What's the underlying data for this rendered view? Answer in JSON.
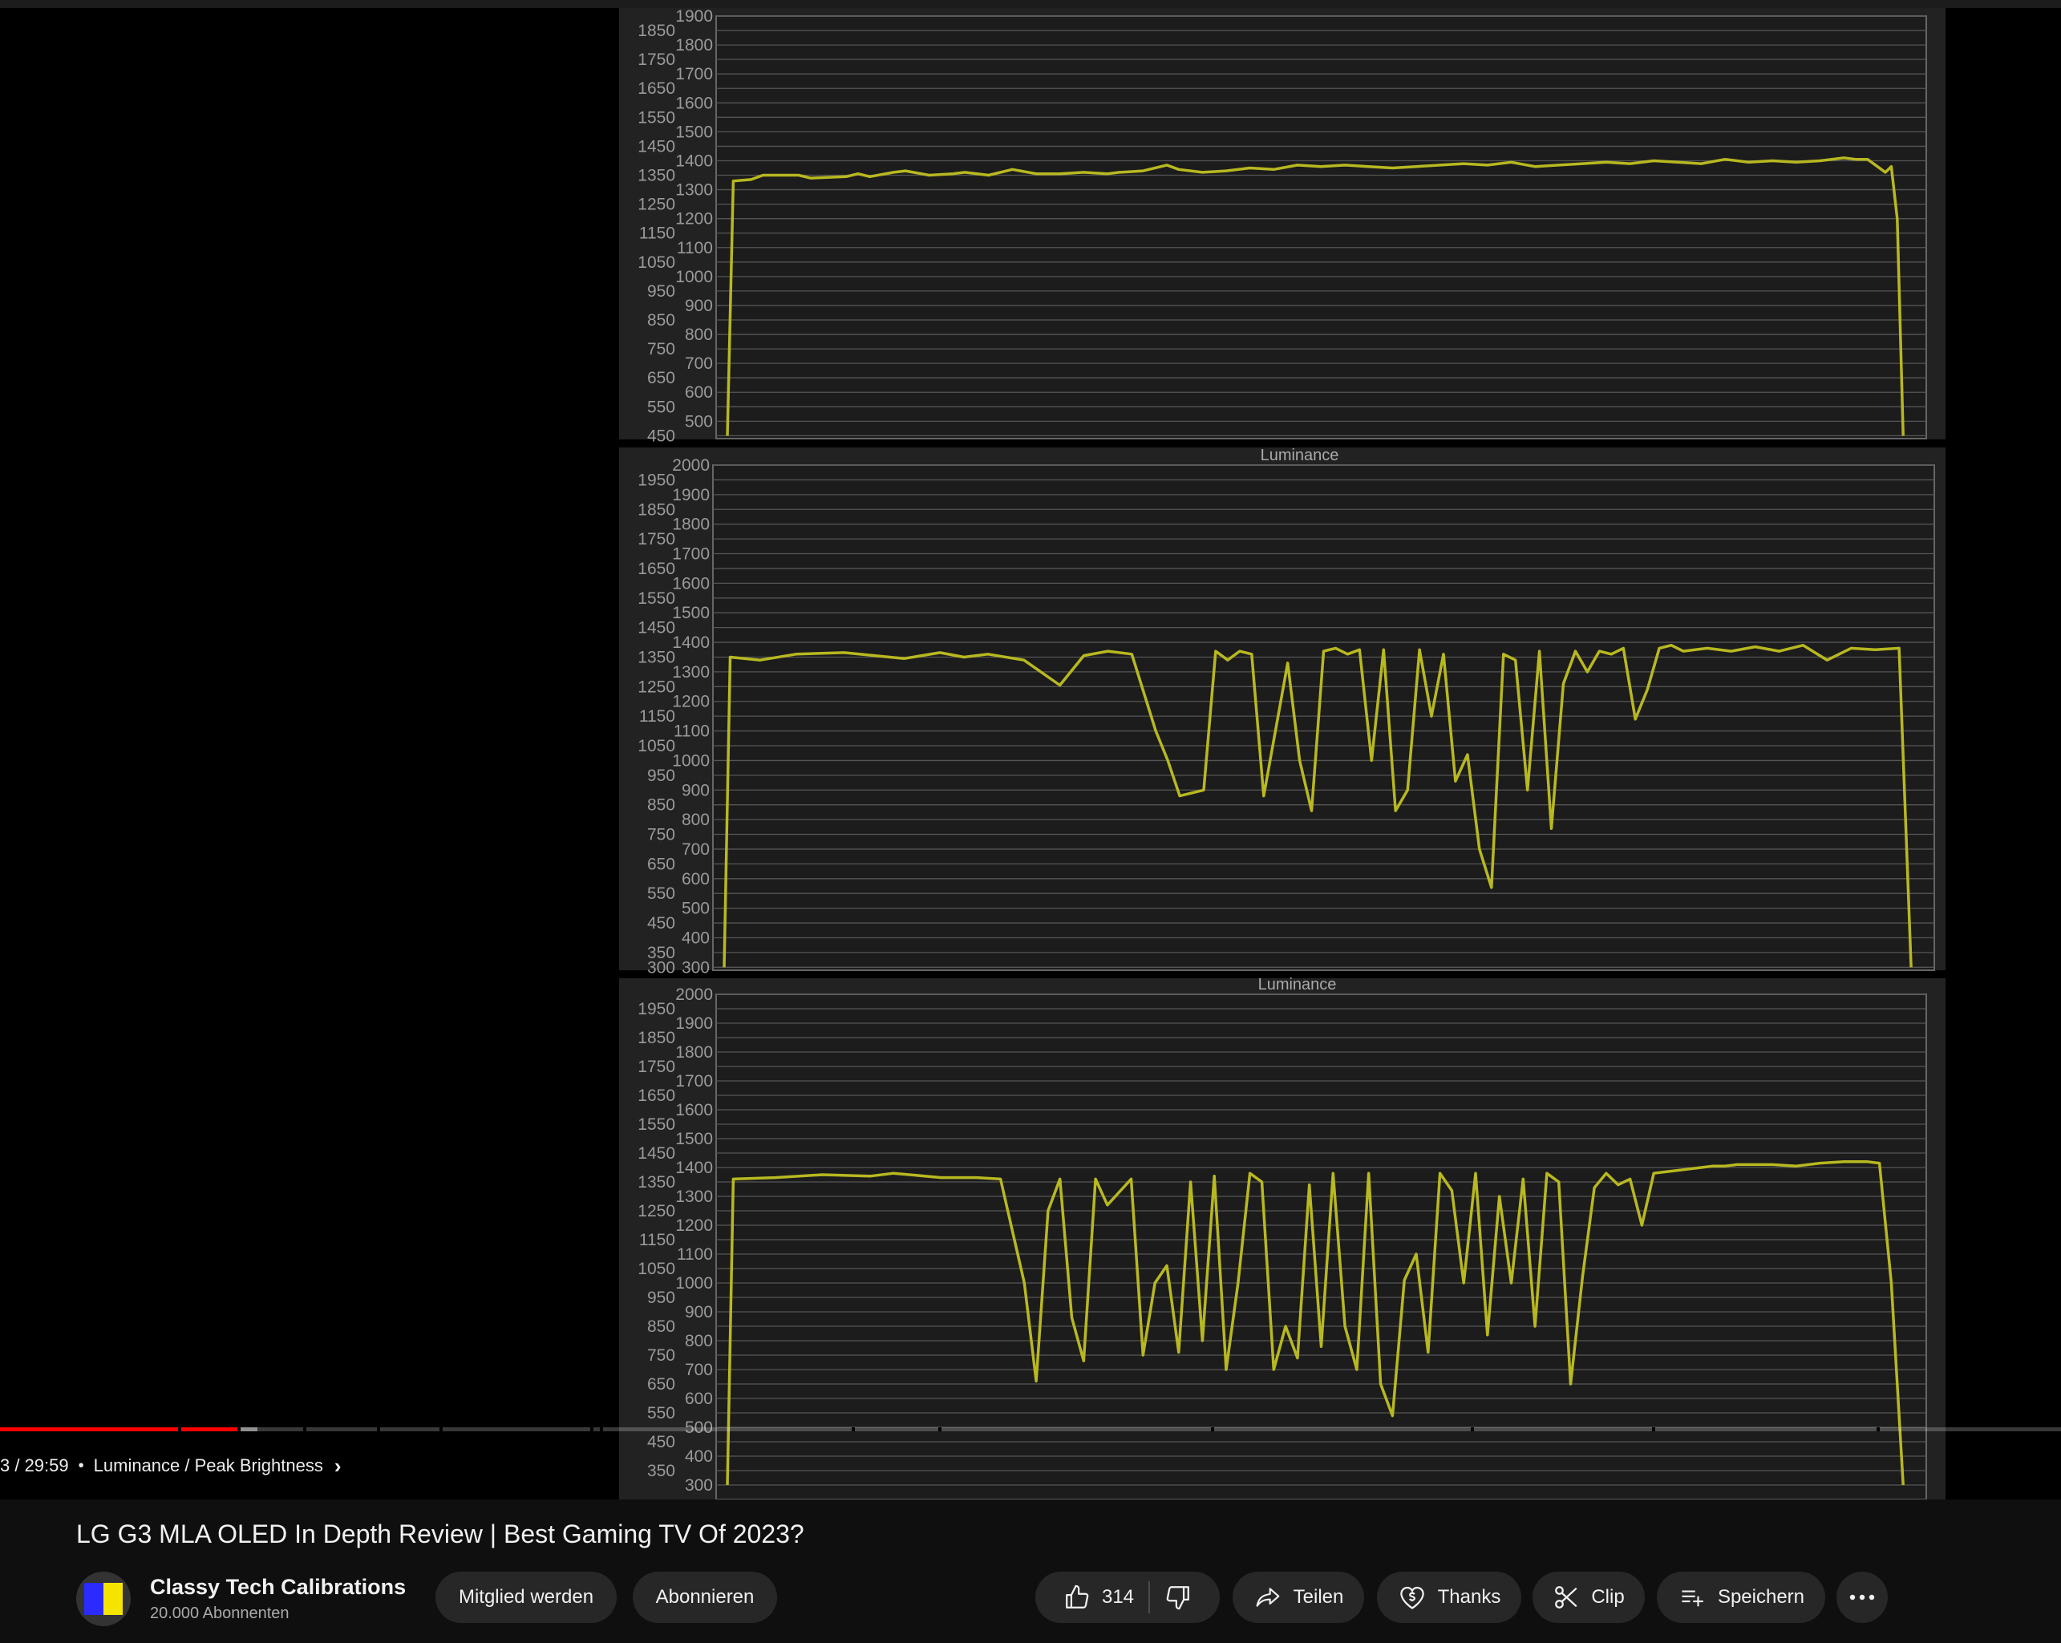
{
  "player": {
    "time": "3 / 29:59",
    "chapter": "Luminance / Peak Brightness",
    "progress_fraction": 0.115,
    "buffered_fraction": 0.125
  },
  "video": {
    "title": "LG G3 MLA OLED In Depth Review | Best Gaming TV Of 2023?"
  },
  "channel": {
    "name": "Classy Tech Calibrations",
    "subscribers": "20.000 Abonnenten",
    "join_label": "Mitglied werden",
    "subscribe_label": "Abonnieren"
  },
  "actions": {
    "like_count": "314",
    "share_label": "Teilen",
    "thanks_label": "Thanks",
    "clip_label": "Clip",
    "save_label": "Speichern"
  },
  "icons": {
    "like": "thumbs-up-icon",
    "dislike": "thumbs-down-icon",
    "share": "share-arrow-icon",
    "thanks": "heart-dollar-icon",
    "clip": "scissors-icon",
    "save": "playlist-add-icon",
    "more": "more-horizontal-icon",
    "chevron": "chevron-right-icon"
  },
  "colors": {
    "series": "#b8b821",
    "progress_played": "#ff0000",
    "button_bg": "#272727"
  },
  "chart_data": [
    {
      "type": "line",
      "title": "",
      "y_outer": [
        450,
        550,
        650,
        750,
        850,
        950,
        1050,
        1150,
        1250,
        1350,
        1450,
        1550,
        1650,
        1750,
        1850
      ],
      "y_inner": [
        500,
        600,
        700,
        800,
        900,
        1000,
        1100,
        1200,
        1300,
        1400,
        1500,
        1600,
        1700,
        1800,
        1900
      ],
      "ylim": [
        440,
        1900
      ],
      "grid": true,
      "series": [
        {
          "x": [
            0,
            0.5,
            2,
            3,
            6,
            7,
            10,
            11,
            12,
            14,
            15,
            17,
            19,
            20,
            22,
            24,
            26,
            28,
            30,
            32,
            33,
            35,
            37,
            38,
            40,
            42,
            44,
            46,
            48,
            50,
            52,
            54,
            56,
            58,
            60,
            62,
            64,
            66,
            68,
            70,
            72,
            74,
            76,
            78,
            80,
            82,
            84,
            86,
            88,
            90,
            92,
            94,
            95,
            96,
            97.5,
            98,
            98.5,
            99
          ],
          "values": [
            450,
            1330,
            1335,
            1350,
            1350,
            1340,
            1345,
            1355,
            1345,
            1360,
            1365,
            1350,
            1355,
            1360,
            1350,
            1370,
            1355,
            1355,
            1360,
            1355,
            1360,
            1365,
            1385,
            1370,
            1360,
            1365,
            1375,
            1370,
            1385,
            1380,
            1385,
            1380,
            1375,
            1380,
            1385,
            1390,
            1385,
            1395,
            1380,
            1385,
            1390,
            1395,
            1390,
            1400,
            1395,
            1390,
            1405,
            1395,
            1400,
            1395,
            1400,
            1410,
            1405,
            1405,
            1360,
            1380,
            1200,
            450
          ]
        }
      ]
    },
    {
      "type": "line",
      "title": "Luminance",
      "y_outer": [
        300,
        350,
        450,
        550,
        650,
        750,
        850,
        950,
        1050,
        1150,
        1250,
        1350,
        1450,
        1550,
        1650,
        1750,
        1850,
        1950
      ],
      "y_inner": [
        300,
        400,
        500,
        600,
        700,
        800,
        900,
        1000,
        1100,
        1200,
        1300,
        1400,
        1500,
        1600,
        1700,
        1800,
        1900,
        2000
      ],
      "ylim": [
        290,
        2000
      ],
      "grid": true,
      "series": [
        {
          "x": [
            0,
            0.5,
            3,
            6,
            10,
            15,
            18,
            20,
            22,
            25,
            28,
            30,
            32,
            34,
            36,
            37,
            38,
            40,
            41,
            42,
            43,
            44,
            45,
            47,
            48,
            49,
            50,
            51,
            52,
            53,
            54,
            55,
            56,
            57,
            58,
            59,
            60,
            61,
            62,
            63,
            64,
            65,
            66,
            67,
            68,
            69,
            70,
            71,
            72,
            73,
            74,
            75,
            76,
            77,
            78,
            79,
            80,
            82,
            84,
            86,
            88,
            90,
            92,
            94,
            96,
            98,
            99
          ],
          "values": [
            300,
            1350,
            1340,
            1360,
            1365,
            1345,
            1365,
            1350,
            1360,
            1340,
            1255,
            1355,
            1370,
            1360,
            1100,
            1000,
            880,
            900,
            1370,
            1340,
            1370,
            1360,
            880,
            1330,
            1000,
            830,
            1370,
            1380,
            1360,
            1375,
            1000,
            1375,
            830,
            900,
            1375,
            1150,
            1360,
            930,
            1020,
            700,
            570,
            1360,
            1340,
            900,
            1370,
            770,
            1260,
            1370,
            1300,
            1370,
            1360,
            1380,
            1140,
            1240,
            1380,
            1390,
            1370,
            1380,
            1370,
            1385,
            1370,
            1390,
            1340,
            1380,
            1375,
            1380,
            300
          ]
        }
      ]
    },
    {
      "type": "line",
      "title": "Luminance",
      "y_outer": [
        350,
        450,
        550,
        650,
        750,
        850,
        950,
        1050,
        1150,
        1250,
        1350,
        1450,
        1550,
        1650,
        1750,
        1850,
        1950
      ],
      "y_inner": [
        300,
        400,
        500,
        600,
        700,
        800,
        900,
        1000,
        1100,
        1200,
        1300,
        1400,
        1500,
        1600,
        1700,
        1800,
        1900,
        2000
      ],
      "ylim": [
        250,
        2000
      ],
      "grid": true,
      "series": [
        {
          "x": [
            0,
            0.5,
            4,
            8,
            12,
            14,
            18,
            21,
            23,
            25,
            26,
            27,
            28,
            29,
            30,
            31,
            32,
            34,
            35,
            36,
            37,
            38,
            39,
            40,
            41,
            42,
            43,
            44,
            45,
            46,
            47,
            48,
            49,
            50,
            51,
            52,
            53,
            54,
            55,
            56,
            57,
            58,
            59,
            60,
            61,
            62,
            63,
            64,
            65,
            66,
            67,
            68,
            69,
            70,
            71,
            72,
            73,
            74,
            75,
            76,
            77,
            78,
            79,
            80,
            81,
            82,
            83,
            84,
            85,
            86,
            87,
            88,
            90,
            92,
            94,
            96,
            97,
            98,
            99
          ],
          "values": [
            300,
            1360,
            1365,
            1375,
            1370,
            1380,
            1365,
            1365,
            1360,
            1000,
            660,
            1250,
            1360,
            880,
            730,
            1360,
            1270,
            1360,
            750,
            1000,
            1060,
            760,
            1350,
            800,
            1370,
            700,
            1000,
            1380,
            1350,
            700,
            850,
            740,
            1340,
            780,
            1380,
            850,
            700,
            1380,
            650,
            540,
            1010,
            1100,
            760,
            1380,
            1320,
            1000,
            1380,
            820,
            1300,
            1000,
            1360,
            850,
            1380,
            1350,
            650,
            1020,
            1330,
            1380,
            1340,
            1360,
            1200,
            1380,
            1385,
            1390,
            1395,
            1400,
            1405,
            1405,
            1410,
            1410,
            1410,
            1410,
            1405,
            1415,
            1420,
            1420,
            1415,
            1000,
            300
          ]
        }
      ]
    }
  ]
}
